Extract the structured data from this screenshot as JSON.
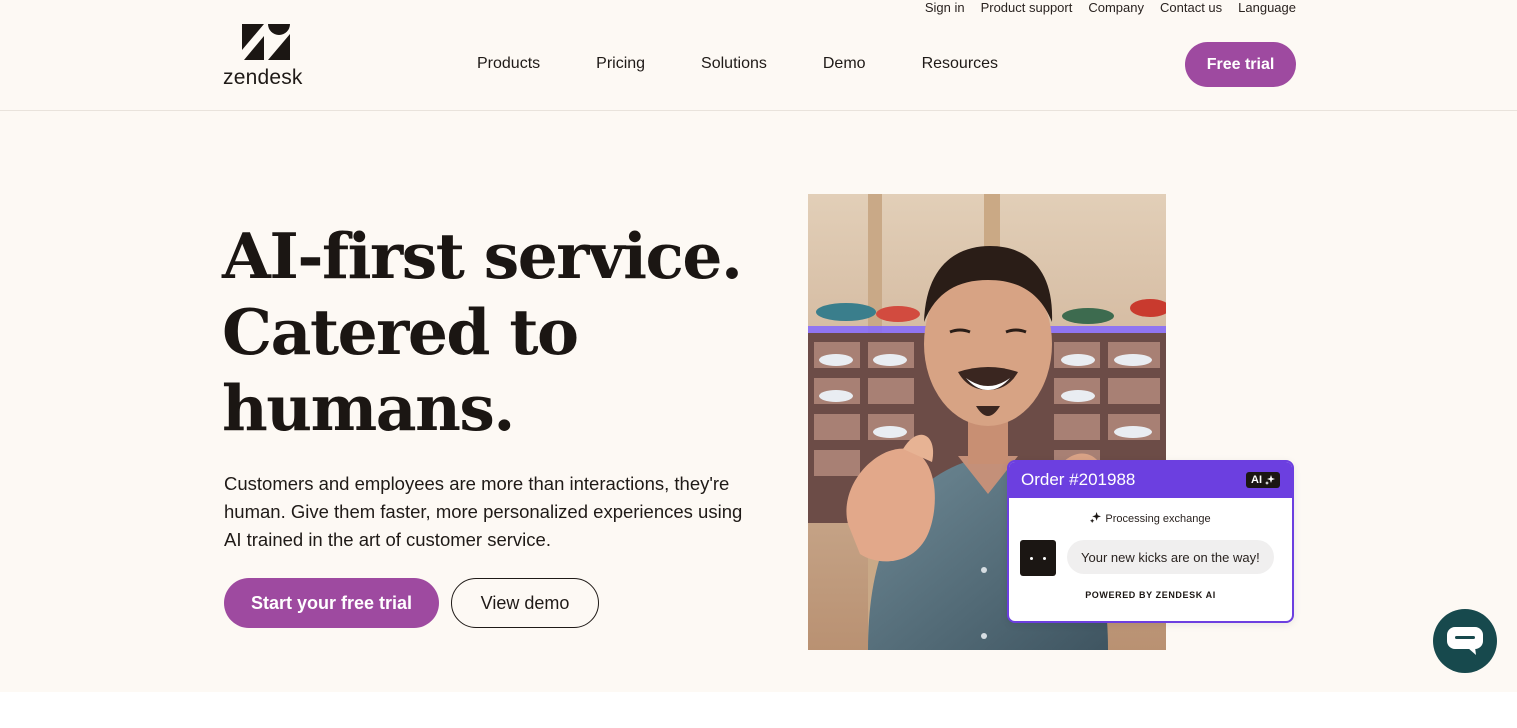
{
  "utility_nav": [
    "Sign in",
    "Product support",
    "Company",
    "Contact us",
    "Language"
  ],
  "logo": {
    "wordmark": "zendesk"
  },
  "main_nav": [
    "Products",
    "Pricing",
    "Solutions",
    "Demo",
    "Resources"
  ],
  "header": {
    "cta": "Free trial"
  },
  "hero": {
    "headline": [
      "AI-first service.",
      "Catered to",
      "humans."
    ],
    "lead": "Customers and employees are more than interactions, they're human. Give them faster, more personalized experiences using AI trained in the art of customer service.",
    "primary_cta": "Start your free trial",
    "secondary_cta": "View demo"
  },
  "order_card": {
    "title": "Order #201988",
    "badge": "AI",
    "status": "Processing exchange",
    "message": "Your new kicks are on the way!",
    "footer": "POWERED BY ZENDESK AI"
  },
  "colors": {
    "brand_purple": "#9e4aa0",
    "card_violet": "#6c3fe0",
    "page_bg": "#fdf9f4",
    "chat_teal": "#17494d"
  },
  "icons": [
    "sparkle-icon",
    "chat-icon",
    "zendesk-logo-icon"
  ]
}
